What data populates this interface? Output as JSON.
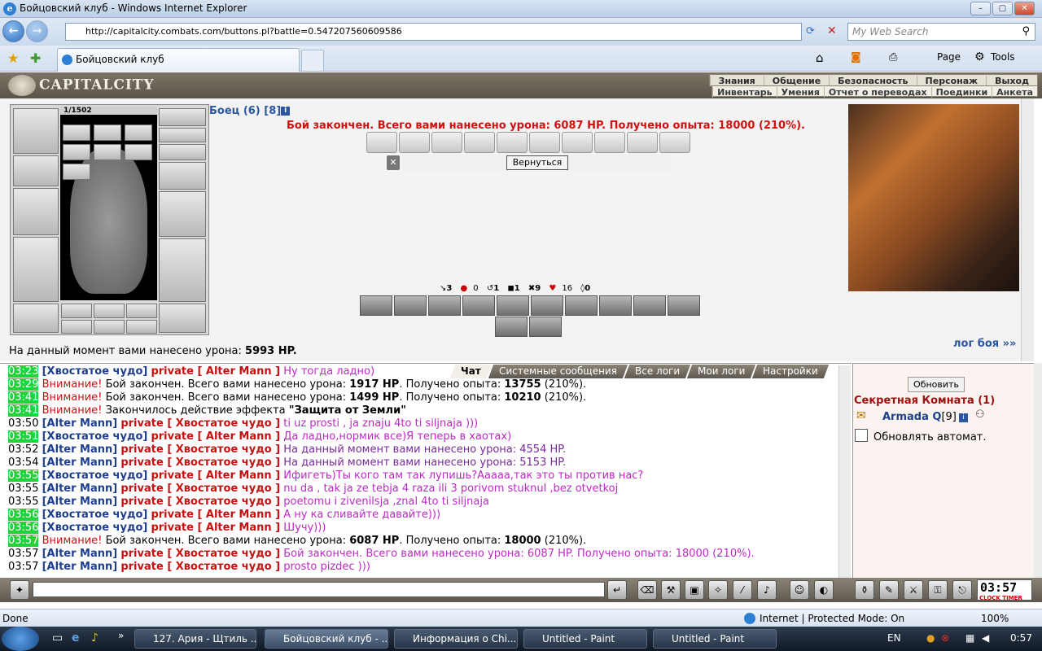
{
  "browser": {
    "window_title": "Бойцовский клуб - Windows Internet Explorer",
    "url": "http://capitalcity.combats.com/buttons.pl?battle=0.547207560609586",
    "search_placeholder": "My Web Search",
    "tab_label": "Бойцовский клуб",
    "toolbar_page": "Page",
    "toolbar_tools": "Tools",
    "status_done": "Done",
    "status_zone": "Internet | Protected Mode: On",
    "zoom": "100%"
  },
  "game_header": {
    "logo": "CAPITALCITY",
    "menu_top": [
      "Знания",
      "Общение",
      "Безопасность",
      "Персонаж",
      "Выход"
    ],
    "menu_bottom": [
      "Инвентарь",
      "Умения",
      "Отчет о переводах",
      "Поединки",
      "Анкета"
    ]
  },
  "character": {
    "hp": "1/1502"
  },
  "battle": {
    "fighter": "Боец (6) [8]",
    "result": "Бой закончен. Всего вами нанесено урона: 6087 HP. Получено опыта: 18000 (210%).",
    "back_button": "Вернуться",
    "stats": [
      "3",
      "0",
      "1",
      "1",
      "9",
      "16",
      "0"
    ],
    "damage_now_label": "На данный момент вами нанесено урона:",
    "damage_now_value": "5993 HP.",
    "log_link": "лог боя »»"
  },
  "chat": {
    "tabs": [
      "Чат",
      "Системные сообщения",
      "Все логи",
      "Мои логи",
      "Настройки"
    ],
    "lines": [
      {
        "time": "03:23",
        "hl": true,
        "who": "[Хвостатое чудо]",
        "to": "private [ Alter Mann ]",
        "msg": "Ну тогда ладно)"
      },
      {
        "time": "03:29",
        "hl": true,
        "warn": "Внимание!",
        "sys": "Бой закончен. Всего вами нанесено урона: ",
        "v1": "1917 HP",
        "mid": ". Получено опыта: ",
        "v2": "13755",
        "end": " (210%)."
      },
      {
        "time": "03:41",
        "hl": true,
        "warn": "Внимание!",
        "sys": "Бой закончен. Всего вами нанесено урона: ",
        "v1": "1499 HP",
        "mid": ". Получено опыта: ",
        "v2": "10210",
        "end": " (210%)."
      },
      {
        "time": "03:41",
        "hl": true,
        "warn": "Внимание!",
        "sys": "Закончилось действие эффекта ",
        "v1": "\"Защита от Земли\""
      },
      {
        "time": "03:50",
        "hl": false,
        "who": "[Alter Mann]",
        "to": "private [ Хвостатое чудо ]",
        "msg": "ti uz prosti , ja znaju 4to ti siljnaja )))"
      },
      {
        "time": "03:51",
        "hl": true,
        "who": "[Хвостатое чудо]",
        "to": "private [ Alter Mann ]",
        "msg": "Да ладно,нормик все)Я теперь в хаотах)"
      },
      {
        "time": "03:52",
        "hl": false,
        "who": "[Alter Mann]",
        "to": "private [ Хвостатое чудо ]",
        "plain": "На данный момент вами нанесено урона: 4554 HP."
      },
      {
        "time": "03:54",
        "hl": false,
        "who": "[Alter Mann]",
        "to": "private [ Хвостатое чудо ]",
        "plain": "На данный момент вами нанесено урона: 5153 HP."
      },
      {
        "time": "03:55",
        "hl": true,
        "who": "[Хвостатое чудо]",
        "to": "private [ Alter Mann ]",
        "msg": "Ифигеть)Ты кого там так лупишь?Ааааа,так это ты против нас?"
      },
      {
        "time": "03:55",
        "hl": false,
        "who": "[Alter Mann]",
        "to": "private [ Хвостатое чудо ]",
        "msg": "nu da , tak ja ze tebja 4 raza ili 3 porivom stuknul ,bez otvetkoj"
      },
      {
        "time": "03:55",
        "hl": false,
        "who": "[Alter Mann]",
        "to": "private [ Хвостатое чудо ]",
        "msg": "poetomu i zivenilsja ,znal 4to ti siljnaja"
      },
      {
        "time": "03:56",
        "hl": true,
        "who": "[Хвостатое чудо]",
        "to": "private [ Alter Mann ]",
        "msg": "А ну ка сливайте давайте)))"
      },
      {
        "time": "03:56",
        "hl": true,
        "who": "[Хвостатое чудо]",
        "to": "private [ Alter Mann ]",
        "msg": "Шучу)))"
      },
      {
        "time": "03:57",
        "hl": true,
        "warn": "Внимание!",
        "sys": "Бой закончен. Всего вами нанесено урона: ",
        "v1": "6087 HP",
        "mid": ". Получено опыта: ",
        "v2": "18000",
        "end": " (210%)."
      },
      {
        "time": "03:57",
        "hl": false,
        "who": "[Alter Mann]",
        "to": "private [ Хвостатое чудо ]",
        "msg": "Бой закончен. Всего вами нанесено урона: 6087 HP. Получено опыта: 18000 (210%)."
      },
      {
        "time": "03:57",
        "hl": false,
        "who": "[Alter Mann]",
        "to": "private [ Хвостатое чудо ]",
        "msg": "prosto pizdec )))"
      }
    ]
  },
  "room": {
    "refresh_button": "Обновить",
    "title": "Секретная Комната (1)",
    "user_name": "Armada Q",
    "user_level": "[9]",
    "auto_refresh_label": "Обновлять автомат."
  },
  "bottom": {
    "clock": "03:57",
    "clock_label": "CLOCK TIMER"
  },
  "taskbar": {
    "items": [
      "127. Ария - Щтиль ...",
      "Бойцовский клуб - ...",
      "Информация о Chi...",
      "Untitled - Paint",
      "Untitled - Paint"
    ],
    "lang": "EN",
    "time": "0:57"
  }
}
